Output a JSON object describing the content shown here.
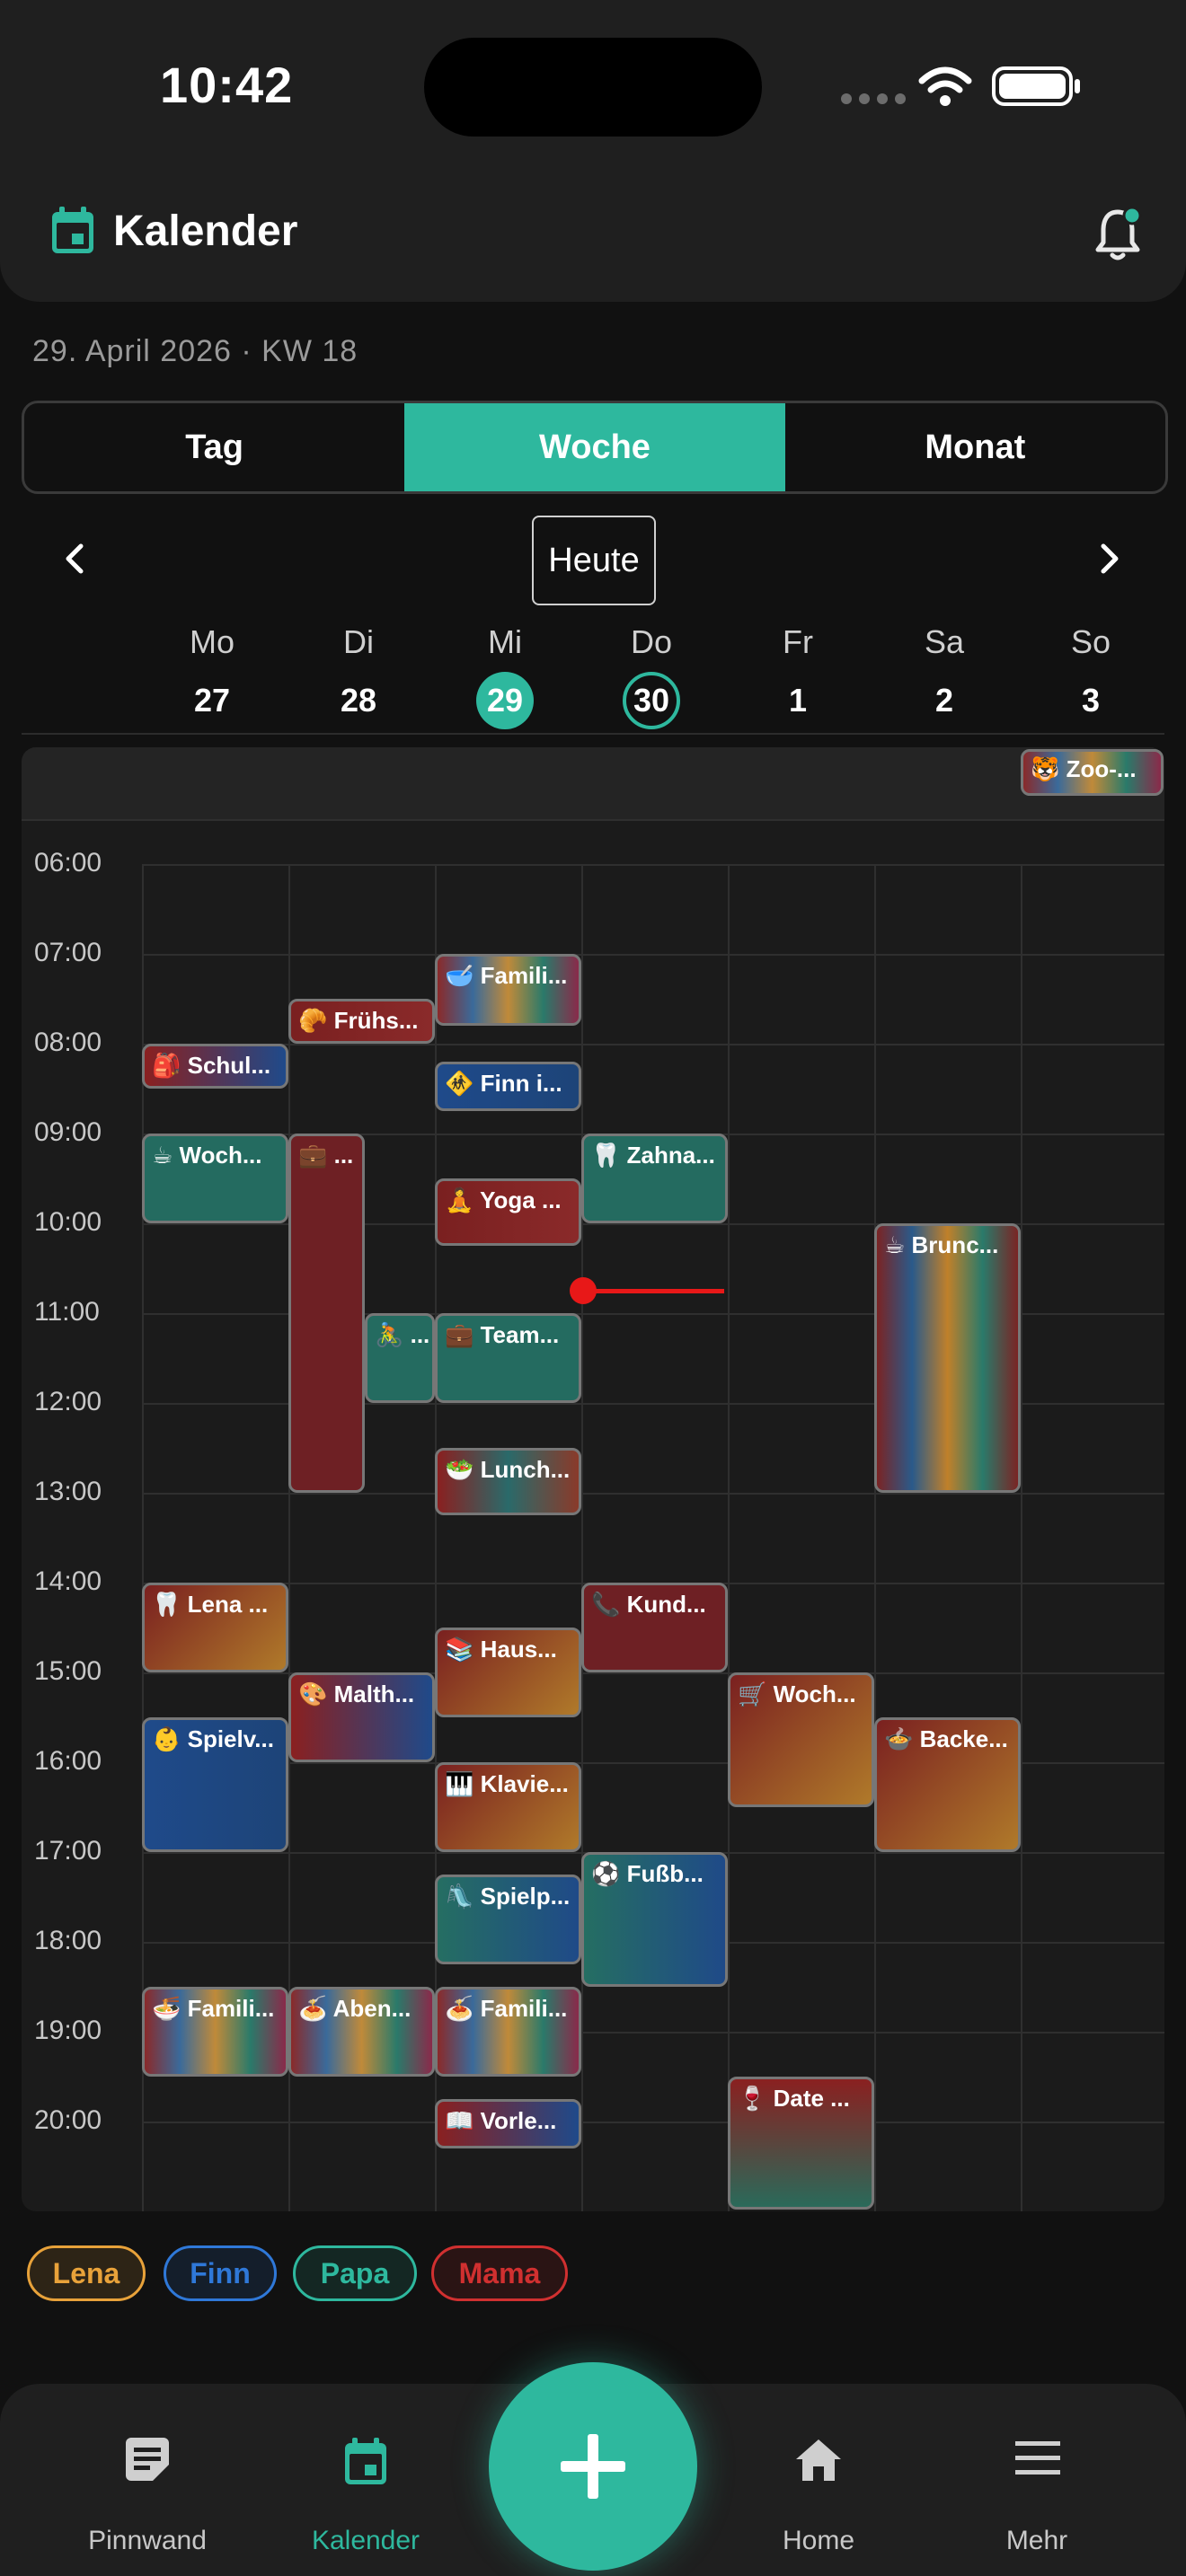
{
  "status": {
    "time": "10:42"
  },
  "header": {
    "title": "Kalender",
    "subtitle": "29. April 2026 · KW 18"
  },
  "tabs": [
    {
      "label": "Tag"
    },
    {
      "label": "Woche"
    },
    {
      "label": "Monat"
    }
  ],
  "nav_week": {
    "today_label": "Heute"
  },
  "days": [
    {
      "name": "Mo",
      "num": "27"
    },
    {
      "name": "Di",
      "num": "28"
    },
    {
      "name": "Mi",
      "num": "29"
    },
    {
      "name": "Do",
      "num": "30"
    },
    {
      "name": "Fr",
      "num": "1"
    },
    {
      "name": "Sa",
      "num": "2"
    },
    {
      "name": "So",
      "num": "3"
    }
  ],
  "hours": [
    "06:00",
    "07:00",
    "08:00",
    "09:00",
    "10:00",
    "11:00",
    "12:00",
    "13:00",
    "14:00",
    "15:00",
    "16:00",
    "17:00",
    "18:00",
    "19:00",
    "20:00"
  ],
  "allday_events": [
    {
      "day": 6,
      "label": "🐯 Zoo-..."
    }
  ],
  "events": [
    {
      "day": 2,
      "start": 7.0,
      "end": 7.8,
      "label": "🥣 Famili...",
      "style": "rainbow"
    },
    {
      "day": 1,
      "start": 7.5,
      "end": 8.0,
      "label": "🥐 Frühs...",
      "style": "red"
    },
    {
      "day": 0,
      "start": 8.0,
      "end": 8.5,
      "label": "🎒 Schul...",
      "style": "redblue"
    },
    {
      "day": 2,
      "start": 8.2,
      "end": 8.75,
      "label": "🚸 Finn i...",
      "style": "blue"
    },
    {
      "day": 0,
      "start": 9.0,
      "end": 10.0,
      "label": "☕ Woch...",
      "style": "teal"
    },
    {
      "day": 1,
      "start": 9.0,
      "end": 13.0,
      "label": "💼 ...",
      "style": "darkred",
      "half": 1
    },
    {
      "day": 3,
      "start": 9.0,
      "end": 10.0,
      "label": "🦷 Zahna...",
      "style": "teal"
    },
    {
      "day": 2,
      "start": 9.5,
      "end": 10.25,
      "label": "🧘 Yoga ...",
      "style": "red"
    },
    {
      "day": 5,
      "start": 10.0,
      "end": 13.0,
      "label": "☕ Brunc...",
      "style": "rainbowv"
    },
    {
      "day": 1,
      "start": 11.0,
      "end": 12.0,
      "label": "🚴 ...",
      "style": "teal",
      "half": 2
    },
    {
      "day": 2,
      "start": 11.0,
      "end": 12.0,
      "label": "💼 Team...",
      "style": "teal"
    },
    {
      "day": 2,
      "start": 12.5,
      "end": 13.25,
      "label": "🥗 Lunch...",
      "style": "redrainbow"
    },
    {
      "day": 0,
      "start": 14.0,
      "end": 15.0,
      "label": "🦷 Lena ...",
      "style": "redorange"
    },
    {
      "day": 3,
      "start": 14.0,
      "end": 15.0,
      "label": "📞 Kund...",
      "style": "darkred"
    },
    {
      "day": 2,
      "start": 14.5,
      "end": 15.5,
      "label": "📚 Haus...",
      "style": "redorange"
    },
    {
      "day": 1,
      "start": 15.0,
      "end": 16.0,
      "label": "🎨 Malth...",
      "style": "redblue"
    },
    {
      "day": 4,
      "start": 15.0,
      "end": 16.5,
      "label": "🛒 Woch...",
      "style": "redorange"
    },
    {
      "day": 0,
      "start": 15.5,
      "end": 17.0,
      "label": "👶 Spielv...",
      "style": "blue"
    },
    {
      "day": 5,
      "start": 15.5,
      "end": 17.0,
      "label": "🍲 Backe...",
      "style": "redorange"
    },
    {
      "day": 2,
      "start": 16.0,
      "end": 17.0,
      "label": "🎹 Klavie...",
      "style": "redorange"
    },
    {
      "day": 3,
      "start": 17.0,
      "end": 18.5,
      "label": "⚽ Fußb...",
      "style": "tealblue"
    },
    {
      "day": 2,
      "start": 17.25,
      "end": 18.25,
      "label": "🛝 Spielp...",
      "style": "tealblue"
    },
    {
      "day": 0,
      "start": 18.5,
      "end": 19.5,
      "label": "🍜 Famili...",
      "style": "rainbow"
    },
    {
      "day": 1,
      "start": 18.5,
      "end": 19.5,
      "label": "🍝 Aben...",
      "style": "rainbow"
    },
    {
      "day": 2,
      "start": 18.5,
      "end": 19.5,
      "label": "🍝 Famili...",
      "style": "rainbow"
    },
    {
      "day": 2,
      "start": 19.75,
      "end": 20.3,
      "label": "📖 Vorle...",
      "style": "redblue"
    },
    {
      "day": 4,
      "start": 19.5,
      "end": 21.0,
      "label": "🍷 Date ...",
      "style": "redteal"
    }
  ],
  "legend": [
    {
      "label": "Lena",
      "color": "#e8a23a"
    },
    {
      "label": "Finn",
      "color": "#2f78d8"
    },
    {
      "label": "Papa",
      "color": "#2eb89e"
    },
    {
      "label": "Mama",
      "color": "#d03030"
    }
  ],
  "bottom_nav": [
    {
      "label": "Pinnwand"
    },
    {
      "label": "Kalender"
    },
    {
      "label": "Home"
    },
    {
      "label": "Mehr"
    }
  ],
  "colors": {
    "accent": "#2eb89e",
    "now_line": "#e81818"
  }
}
